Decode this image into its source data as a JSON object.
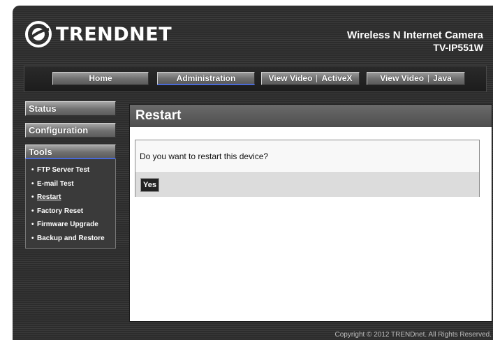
{
  "brand": {
    "name": "TRENDNET",
    "logo_icon": "trendnet-swirl-icon"
  },
  "product": {
    "name": "Wireless N Internet Camera",
    "model": "TV-IP551W"
  },
  "nav": {
    "home": "Home",
    "administration": "Administration",
    "view_activex": {
      "left": "View Video",
      "right": "ActiveX"
    },
    "view_java": {
      "left": "View Video",
      "right": "Java"
    }
  },
  "sidebar": {
    "status": "Status",
    "configuration": "Configuration",
    "tools": "Tools",
    "tools_items": [
      "FTP Server Test",
      "E-mail Test",
      "Restart",
      "Factory Reset",
      "Firmware Upgrade",
      "Backup and Restore"
    ]
  },
  "content": {
    "title": "Restart",
    "question": "Do you want to restart this device?",
    "yes_label": "Yes"
  },
  "footer": "Copyright © 2012 TRENDnet. All Rights Reserved.",
  "colors": {
    "accent": "#4a6ad8",
    "background": "#2c2c2c"
  }
}
